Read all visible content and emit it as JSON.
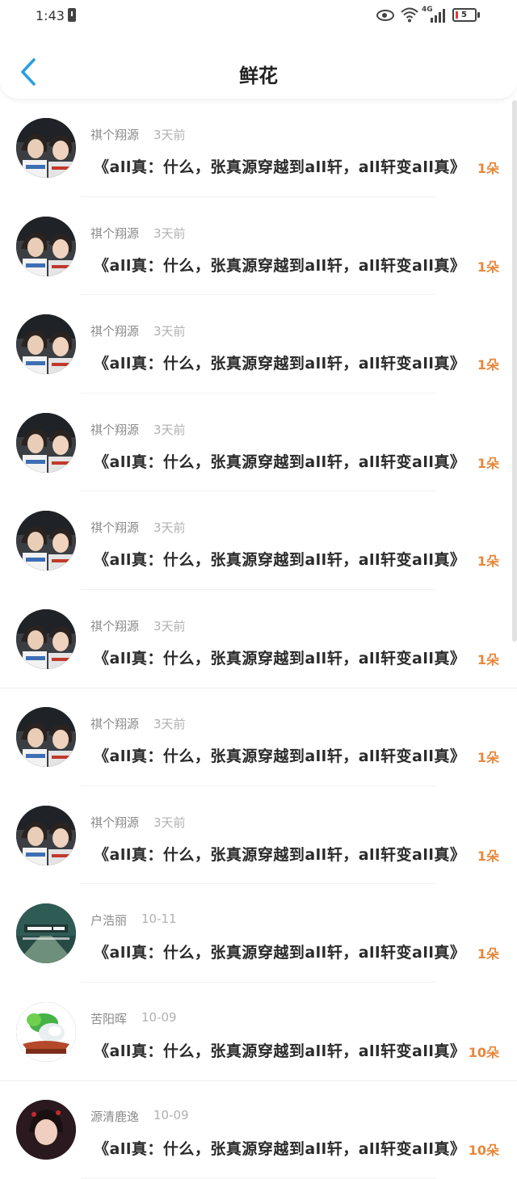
{
  "status_bar": {
    "time": "1:43",
    "network": "4G",
    "battery": "5"
  },
  "header": {
    "title": "鲜花"
  },
  "colors": {
    "accent": "#2a9fe0",
    "flower_count": "#e8873a"
  },
  "items": [
    {
      "name": "祺个翔源",
      "time": "3天前",
      "title": "《all真：什么，张真源穿越到all轩，all轩变all真》",
      "flowers": "1朵",
      "avatar": "avatar-photo-duo"
    },
    {
      "name": "祺个翔源",
      "time": "3天前",
      "title": "《all真：什么，张真源穿越到all轩，all轩变all真》",
      "flowers": "1朵",
      "avatar": "avatar-photo-duo"
    },
    {
      "name": "祺个翔源",
      "time": "3天前",
      "title": "《all真：什么，张真源穿越到all轩，all轩变all真》",
      "flowers": "1朵",
      "avatar": "avatar-photo-duo"
    },
    {
      "name": "祺个翔源",
      "time": "3天前",
      "title": "《all真：什么，张真源穿越到all轩，all轩变all真》",
      "flowers": "1朵",
      "avatar": "avatar-photo-duo"
    },
    {
      "name": "祺个翔源",
      "time": "3天前",
      "title": "《all真：什么，张真源穿越到all轩，all轩变all真》",
      "flowers": "1朵",
      "avatar": "avatar-photo-duo"
    },
    {
      "name": "祺个翔源",
      "time": "3天前",
      "title": "《all真：什么，张真源穿越到all轩，all轩变all真》",
      "flowers": "1朵",
      "avatar": "avatar-photo-duo"
    },
    {
      "name": "祺个翔源",
      "time": "3天前",
      "title": "《all真：什么，张真源穿越到all轩，all轩变all真》",
      "flowers": "1朵",
      "avatar": "avatar-photo-duo"
    },
    {
      "name": "祺个翔源",
      "time": "3天前",
      "title": "《all真：什么，张真源穿越到all轩，all轩变all真》",
      "flowers": "1朵",
      "avatar": "avatar-photo-duo"
    },
    {
      "name": "户浩丽",
      "time": "10-11",
      "title": "《all真：什么，张真源穿越到all轩，all轩变all真》",
      "flowers": "1朵",
      "avatar": "avatar-photo-street"
    },
    {
      "name": "苦阳晖",
      "time": "10-09",
      "title": "《all真：什么，张真源穿越到all轩，all轩变all真》",
      "flowers": "10朵",
      "avatar": "avatar-photo-jade"
    },
    {
      "name": "源清鹿逸",
      "time": "10-09",
      "title": "《all真：什么，张真源穿越到all轩，all轩变all真》",
      "flowers": "10朵",
      "avatar": "avatar-photo-portrait"
    }
  ]
}
